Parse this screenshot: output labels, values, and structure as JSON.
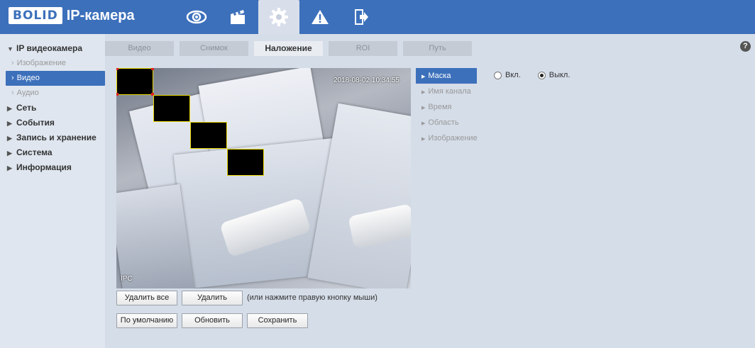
{
  "header": {
    "logo": "BOLID",
    "title": "IP-камера",
    "nav": [
      {
        "icon": "eye-icon",
        "active": false
      },
      {
        "icon": "clapperboard-icon",
        "active": false
      },
      {
        "icon": "gear-icon",
        "active": true
      },
      {
        "icon": "warning-icon",
        "active": false
      },
      {
        "icon": "logout-icon",
        "active": false
      }
    ]
  },
  "sidebar": {
    "section_title": "IP видеокамера",
    "sub_items": [
      {
        "label": "Изображение",
        "active": false
      },
      {
        "label": "Видео",
        "active": true
      },
      {
        "label": "Аудио",
        "active": false
      }
    ],
    "sections": [
      "Сеть",
      "События",
      "Запись и хранение",
      "Система",
      "Информация"
    ]
  },
  "tabs": [
    {
      "label": "Видео",
      "active": false
    },
    {
      "label": "Снимок",
      "active": false
    },
    {
      "label": "Наложение",
      "active": true
    },
    {
      "label": "ROI",
      "active": false
    },
    {
      "label": "Путь",
      "active": false
    }
  ],
  "help": "?",
  "video": {
    "timestamp": "2018-08-02 10:34:55",
    "camera_label": "IPC",
    "mask_count": 4
  },
  "submenu": [
    {
      "label": "Маска",
      "active": true
    },
    {
      "label": "Имя канала",
      "active": false
    },
    {
      "label": "Время",
      "active": false
    },
    {
      "label": "Область",
      "active": false
    },
    {
      "label": "Изображение",
      "active": false
    }
  ],
  "mask_mode": {
    "on_label": "Вкл.",
    "off_label": "Выкл.",
    "selected": "off"
  },
  "buttons": {
    "delete_all": "Удалить все",
    "delete": "Удалить",
    "hint": "(или нажмите правую кнопку мыши)",
    "default": "По умолчанию",
    "refresh": "Обновить",
    "save": "Сохранить"
  },
  "colors": {
    "header": "#3c70bb",
    "accent": "#3c70bb",
    "mask_border": "#e8d800",
    "mask_handle": "#e02020"
  }
}
